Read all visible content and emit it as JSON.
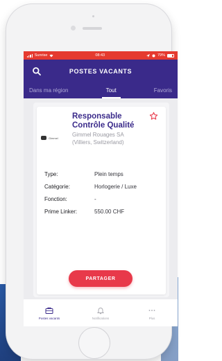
{
  "status_bar": {
    "carrier": "Sunrise",
    "time": "08:43",
    "battery": "79%"
  },
  "header": {
    "title": "POSTES VACANTS"
  },
  "tabs": [
    {
      "label": "Dans ma région"
    },
    {
      "label": "Tout"
    },
    {
      "label": "Favoris"
    }
  ],
  "job": {
    "title_line1": "Responsable",
    "title_line2": "Contrôle Qualité",
    "company": "Gimmel Rouages SA",
    "location": "(Villiers, Switzerland)",
    "details": [
      {
        "label": "Type:",
        "value": "Plein temps"
      },
      {
        "label": "Catégorie:",
        "value": "Horlogerie / Luxe"
      },
      {
        "label": "Fonction:",
        "value": "-"
      },
      {
        "label": "Prime Linker:",
        "value": "550.00 CHF"
      }
    ],
    "share_label": "PARTAGER"
  },
  "bottom_nav": [
    {
      "label": "Postes vacants"
    },
    {
      "label": "Notifications"
    },
    {
      "label": "Plus"
    }
  ],
  "colors": {
    "primary": "#3a2a8a",
    "accent": "#e8394a",
    "status_bar": "#e53a2f"
  }
}
